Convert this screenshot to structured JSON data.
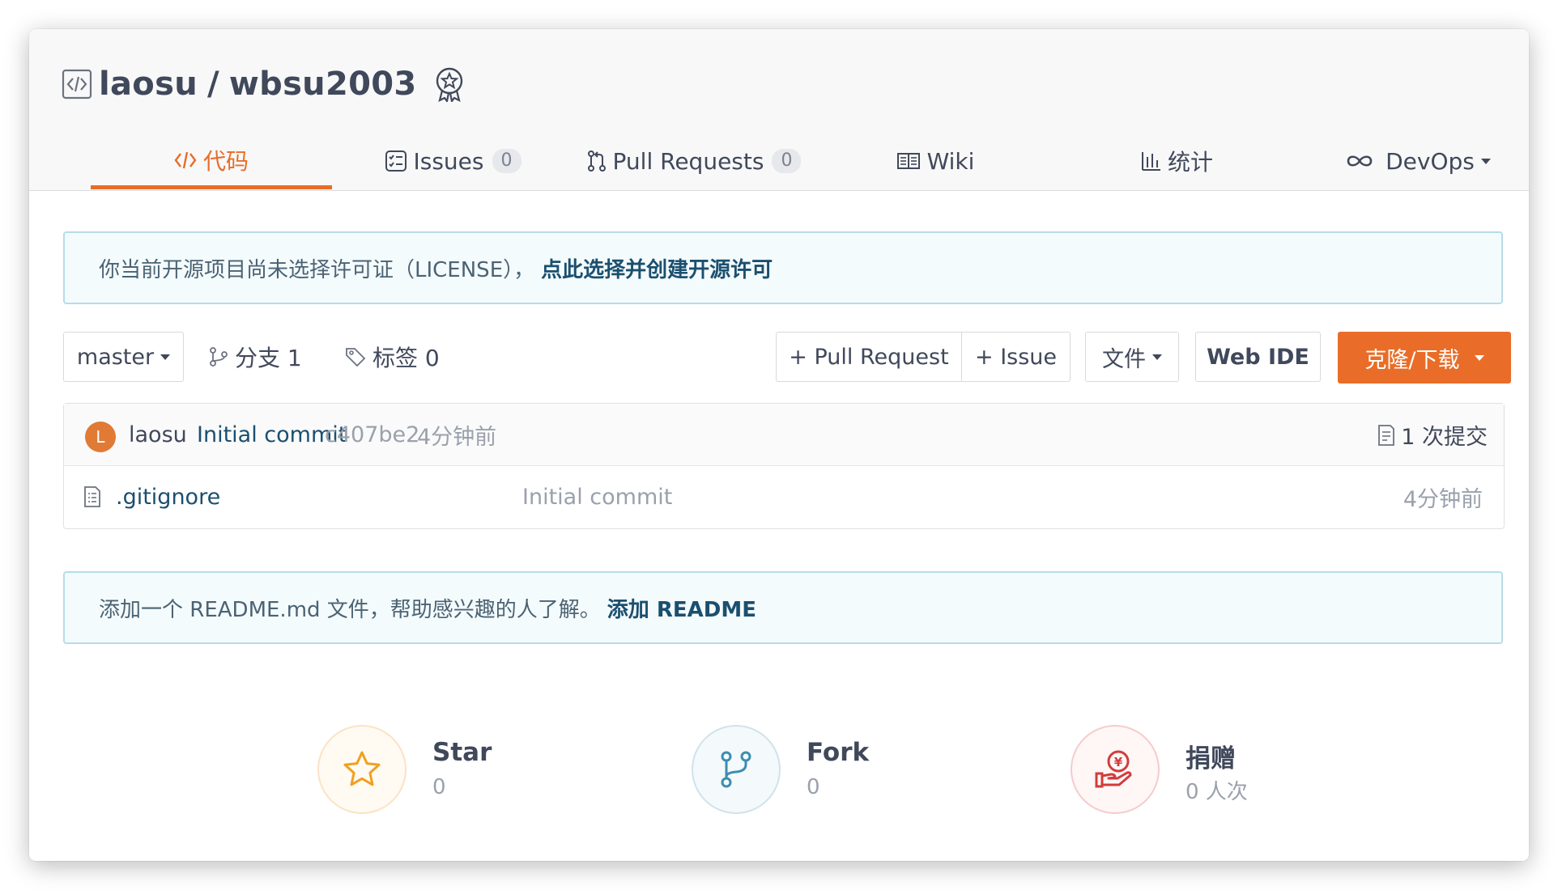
{
  "repo": {
    "owner": "laosu",
    "separator": "/",
    "name": "wbsu2003"
  },
  "tabs": [
    {
      "label": "代码",
      "icon": "code-icon"
    },
    {
      "label": "Issues",
      "count": "0",
      "icon": "issues-icon"
    },
    {
      "label": "Pull Requests",
      "count": "0",
      "icon": "pull-request-icon"
    },
    {
      "label": "Wiki",
      "icon": "wiki-book-icon"
    },
    {
      "label": "统计",
      "icon": "bar-chart-icon"
    },
    {
      "label": "DevOps",
      "icon": "infinity-icon"
    }
  ],
  "license_notice": {
    "text": "你当前开源项目尚未选择许可证（LICENSE），",
    "link": "点此选择并创建开源许可"
  },
  "toolbar": {
    "branch": "master",
    "branches_label": "分支 1",
    "tags_label": "标签 0",
    "pull_request_button": "+ Pull Request",
    "issue_button": "+ Issue",
    "file_button": "文件",
    "web_ide_button": "Web IDE",
    "clone_button": "克隆/下载"
  },
  "latest_commit": {
    "avatar_letter": "L",
    "author": "laosu",
    "message": "Initial commit",
    "hash": "c407be2",
    "time": "4分钟前",
    "commit_count_label": "1 次提交"
  },
  "files": [
    {
      "name": ".gitignore",
      "commit_message": "Initial commit",
      "time": "4分钟前"
    }
  ],
  "readme_notice": {
    "text": "添加一个 README.md 文件，帮助感兴趣的人了解。",
    "link": "添加 README"
  },
  "stats": {
    "star": {
      "label": "Star",
      "value": "0"
    },
    "fork": {
      "label": "Fork",
      "value": "0"
    },
    "donate": {
      "label": "捐赠",
      "value": "0 人次"
    }
  },
  "colors": {
    "accent": "#e96d28",
    "link": "#1b4f6f",
    "text": "#40485b",
    "muted": "#9aa1ac"
  }
}
